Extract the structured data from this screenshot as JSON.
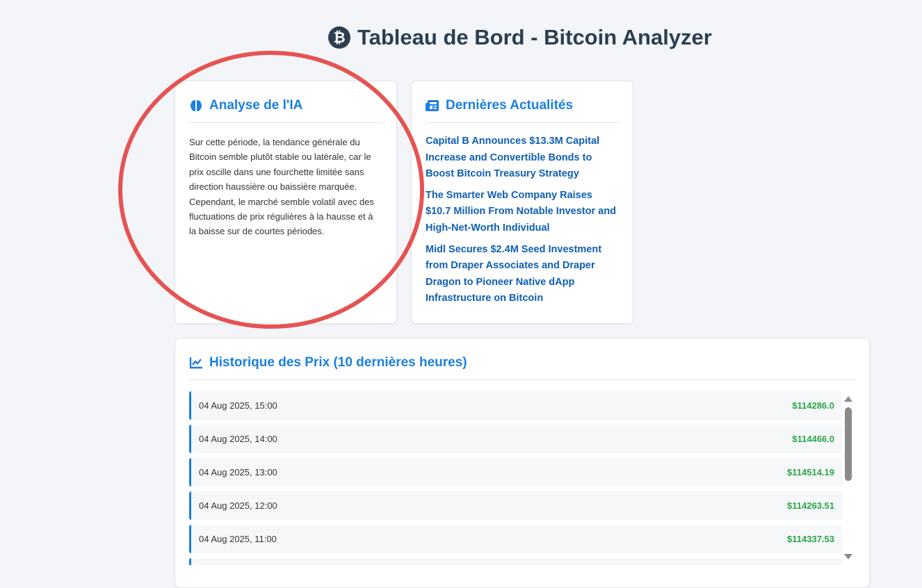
{
  "header": {
    "title": "Tableau de Bord - Bitcoin Analyzer",
    "icon": "bitcoin-icon"
  },
  "ai_card": {
    "title": "Analyse de l'IA",
    "icon": "brain-icon",
    "text": "Sur cette période, la tendance générale du Bitcoin semble plutôt stable ou latérale, car le prix oscille dans une fourchette limitée sans direction haussière ou baissière marquée. Cependant, le marché semble volatil avec des fluctuations de prix régulières à la hausse et à la baisse sur de courtes périodes."
  },
  "news_card": {
    "title": "Dernières Actualités",
    "icon": "newspaper-icon",
    "items": [
      {
        "label": "Capital B Announces $13.3M Capital Increase and Convertible Bonds to Boost Bitcoin Treasury Strategy"
      },
      {
        "label": "The Smarter Web Company Raises $10.7 Million From Notable Investor and High-Net-Worth Individual"
      },
      {
        "label": "Midl Secures $2.4M Seed Investment from Draper Associates and Draper Dragon to Pioneer Native dApp Infrastructure on Bitcoin"
      }
    ]
  },
  "history_card": {
    "title": "Historique des Prix (10 dernières heures)",
    "icon": "chart-line-icon",
    "rows": [
      {
        "time": "04 Aug 2025, 15:00",
        "price": "$114286.0"
      },
      {
        "time": "04 Aug 2025, 14:00",
        "price": "$114466.0"
      },
      {
        "time": "04 Aug 2025, 13:00",
        "price": "$114514.19"
      },
      {
        "time": "04 Aug 2025, 12:00",
        "price": "$114263.51"
      },
      {
        "time": "04 Aug 2025, 11:00",
        "price": "$114337.53"
      },
      {
        "time": "",
        "price": ""
      }
    ]
  },
  "colors": {
    "accent": "#1a7fe0",
    "link": "#0f5fb3",
    "price": "#28a745",
    "annotation": "#e55353",
    "title": "#2c3e50"
  }
}
